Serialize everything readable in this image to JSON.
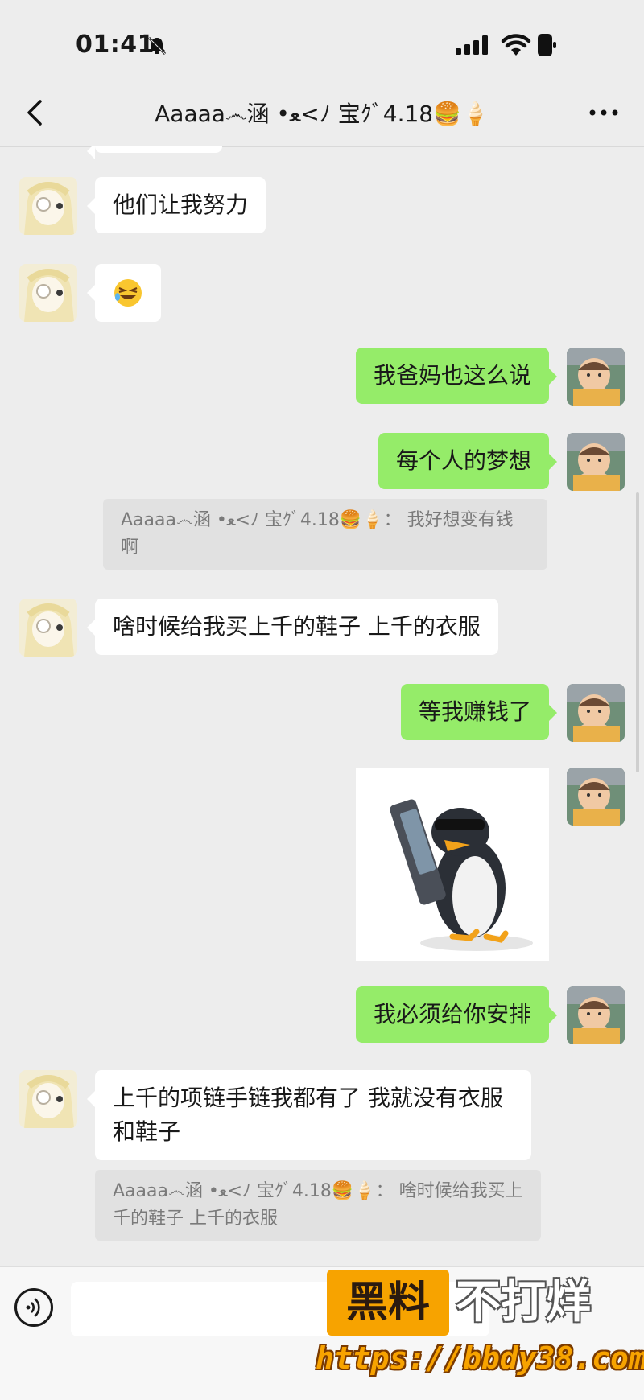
{
  "status_bar": {
    "time": "01:41"
  },
  "header": {
    "title": "Aaaaa෴涵 •ﻌ<ﾉ 宝ｸﾞ4.18🍔🍦"
  },
  "messages": [
    {
      "side": "left",
      "text": "他们让我努力"
    },
    {
      "side": "left",
      "emoji": "😂"
    },
    {
      "side": "right",
      "text": "我爸妈也这么说"
    },
    {
      "side": "right",
      "text": "每个人的梦想",
      "quote": "Aaaaa෴涵 •ﻌ<ﾉ 宝ｸﾞ4.18🍔🍦： 我好想变有钱啊"
    },
    {
      "side": "left",
      "text": "啥时候给我买上千的鞋子 上千的衣服"
    },
    {
      "side": "right",
      "text": "等我赚钱了"
    },
    {
      "side": "right",
      "sticker": "penguin-with-phone"
    },
    {
      "side": "right",
      "text": "我必须给你安排"
    },
    {
      "side": "left",
      "text": "上千的项链手链我都有了 我就没有衣服和鞋子",
      "quote": "Aaaaa෴涵 •ﻌ<ﾉ 宝ｸﾞ4.18🍔🍦： 啥时候给我买上千的鞋子 上千的衣服"
    }
  ],
  "watermark": {
    "brand_left": "黑料",
    "brand_right": "不打烊",
    "url": "https://bbdy38.com"
  },
  "colors": {
    "background": "#ededed",
    "bubble_self": "#95ec69",
    "bubble_other": "#ffffff",
    "quote_bg": "#e1e1e1",
    "watermark_orange": "#f7a300"
  },
  "icons": [
    "mute-bell-icon",
    "signal-icon",
    "wifi-icon",
    "battery-icon",
    "back-chevron-icon",
    "more-dots-icon",
    "voice-icon"
  ]
}
